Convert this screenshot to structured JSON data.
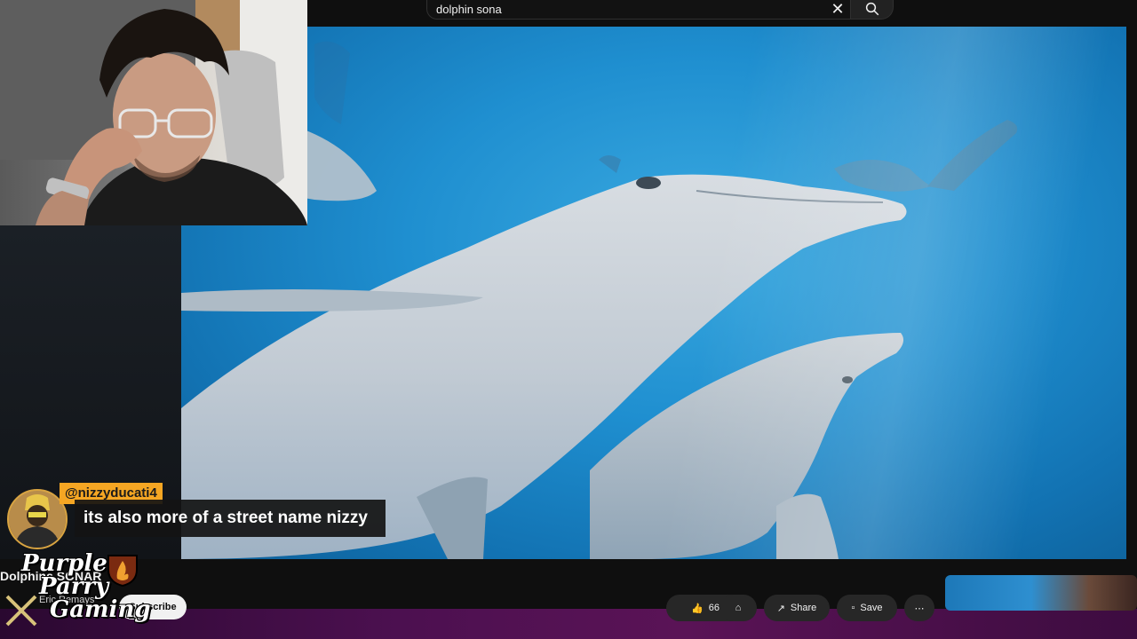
{
  "search": {
    "query": "dolphin sona",
    "clear_icon": "close-icon",
    "search_icon": "search-icon"
  },
  "chat": {
    "username": "@nizzyducati4",
    "message": "its also more of a street name nizzy"
  },
  "channel": {
    "name": "Dolphins SONAR",
    "subtitle": "Eric Remays",
    "subscribe_label": "Subscribe"
  },
  "actions": {
    "like_count": "66",
    "share_label": "Share",
    "save_label": "Save"
  },
  "logo": {
    "line1": "Purple",
    "line2": "Parry",
    "line3": "Gaming"
  },
  "colors": {
    "chat_username_bg": "#f5a623",
    "logo_accent": "#d64b1e",
    "purple_band": "#4c1050"
  }
}
